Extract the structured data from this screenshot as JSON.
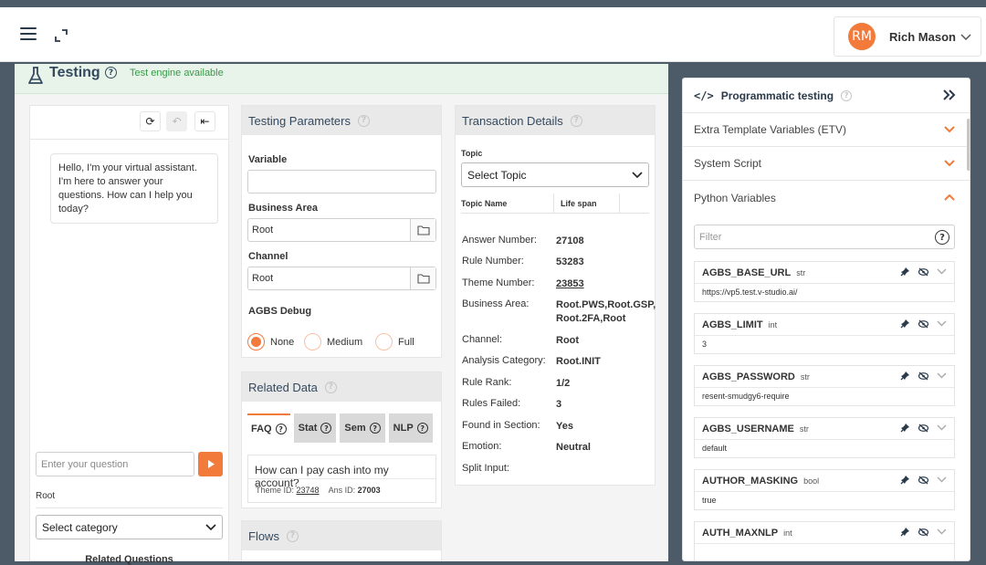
{
  "header": {
    "user_initials": "RM",
    "user_name": "Rich Mason"
  },
  "testing": {
    "title": "Testing",
    "status": "Test engine available"
  },
  "chat": {
    "greeting": "Hello, I'm your virtual assistant. I'm here to answer your questions. How can I help you today?",
    "input_placeholder": "Enter your question",
    "context_label": "Root",
    "category_select": "Select category",
    "related_questions": "Related Questions"
  },
  "testing_parameters": {
    "title": "Testing Parameters",
    "variable_label": "Variable",
    "variable_value": "",
    "business_area_label": "Business Area",
    "business_area_value": "Root",
    "channel_label": "Channel",
    "channel_value": "Root",
    "debug_label": "AGBS Debug",
    "debug_options": [
      "None",
      "Medium",
      "Full"
    ],
    "debug_selected": "None"
  },
  "related_data": {
    "title": "Related Data",
    "tabs": [
      "FAQ",
      "Stat",
      "Sem",
      "NLP"
    ],
    "active_tab": "FAQ",
    "faq_question": "How can I pay cash into my account?",
    "theme_id_label": "Theme ID:",
    "theme_id": "23748",
    "ans_id_label": "Ans ID:",
    "ans_id": "27003"
  },
  "flows": {
    "title": "Flows"
  },
  "transaction_details": {
    "title": "Transaction Details",
    "topic_label": "Topic",
    "topic_select": "Select Topic",
    "col_topic_name": "Topic Name",
    "col_life_span": "Life span",
    "rows": [
      {
        "key": "Answer Number:",
        "value": "27108"
      },
      {
        "key": "Rule Number:",
        "value": "53283"
      },
      {
        "key": "Theme Number:",
        "value": "23853"
      },
      {
        "key": "Business Area:",
        "value": "Root.PWS,Root.GSP, Root.2FA,Root"
      },
      {
        "key": "Channel:",
        "value": "Root"
      },
      {
        "key": "Analysis Category:",
        "value": "Root.INIT"
      },
      {
        "key": "Rule Rank:",
        "value": "1/2"
      },
      {
        "key": "Rules Failed:",
        "value": "3"
      },
      {
        "key": "Found in Section:",
        "value": "Yes"
      },
      {
        "key": "Emotion:",
        "value": "Neutral"
      },
      {
        "key": "Split Input:",
        "value": ""
      }
    ]
  },
  "programmatic": {
    "title": "Programmatic testing",
    "code_glyph": "</>",
    "sections": [
      "Extra Template Variables (ETV)",
      "System Script",
      "Python Variables"
    ],
    "filter_placeholder": "Filter",
    "variables": [
      {
        "name": "AGBS_BASE_URL",
        "type": "str",
        "value": "https://vp5.test.v-studio.ai/"
      },
      {
        "name": "AGBS_LIMIT",
        "type": "int",
        "value": "3"
      },
      {
        "name": "AGBS_PASSWORD",
        "type": "str",
        "value": "resent-smudgy6-require"
      },
      {
        "name": "AGBS_USERNAME",
        "type": "str",
        "value": "default"
      },
      {
        "name": "AUTHOR_MASKING",
        "type": "bool",
        "value": "true"
      },
      {
        "name": "AUTH_MAXNLP",
        "type": "int",
        "value": ""
      }
    ]
  },
  "colors": {
    "accent": "#f27a3a",
    "status_green": "#3a9a4a",
    "header_green_bg": "#e8f3e9"
  }
}
